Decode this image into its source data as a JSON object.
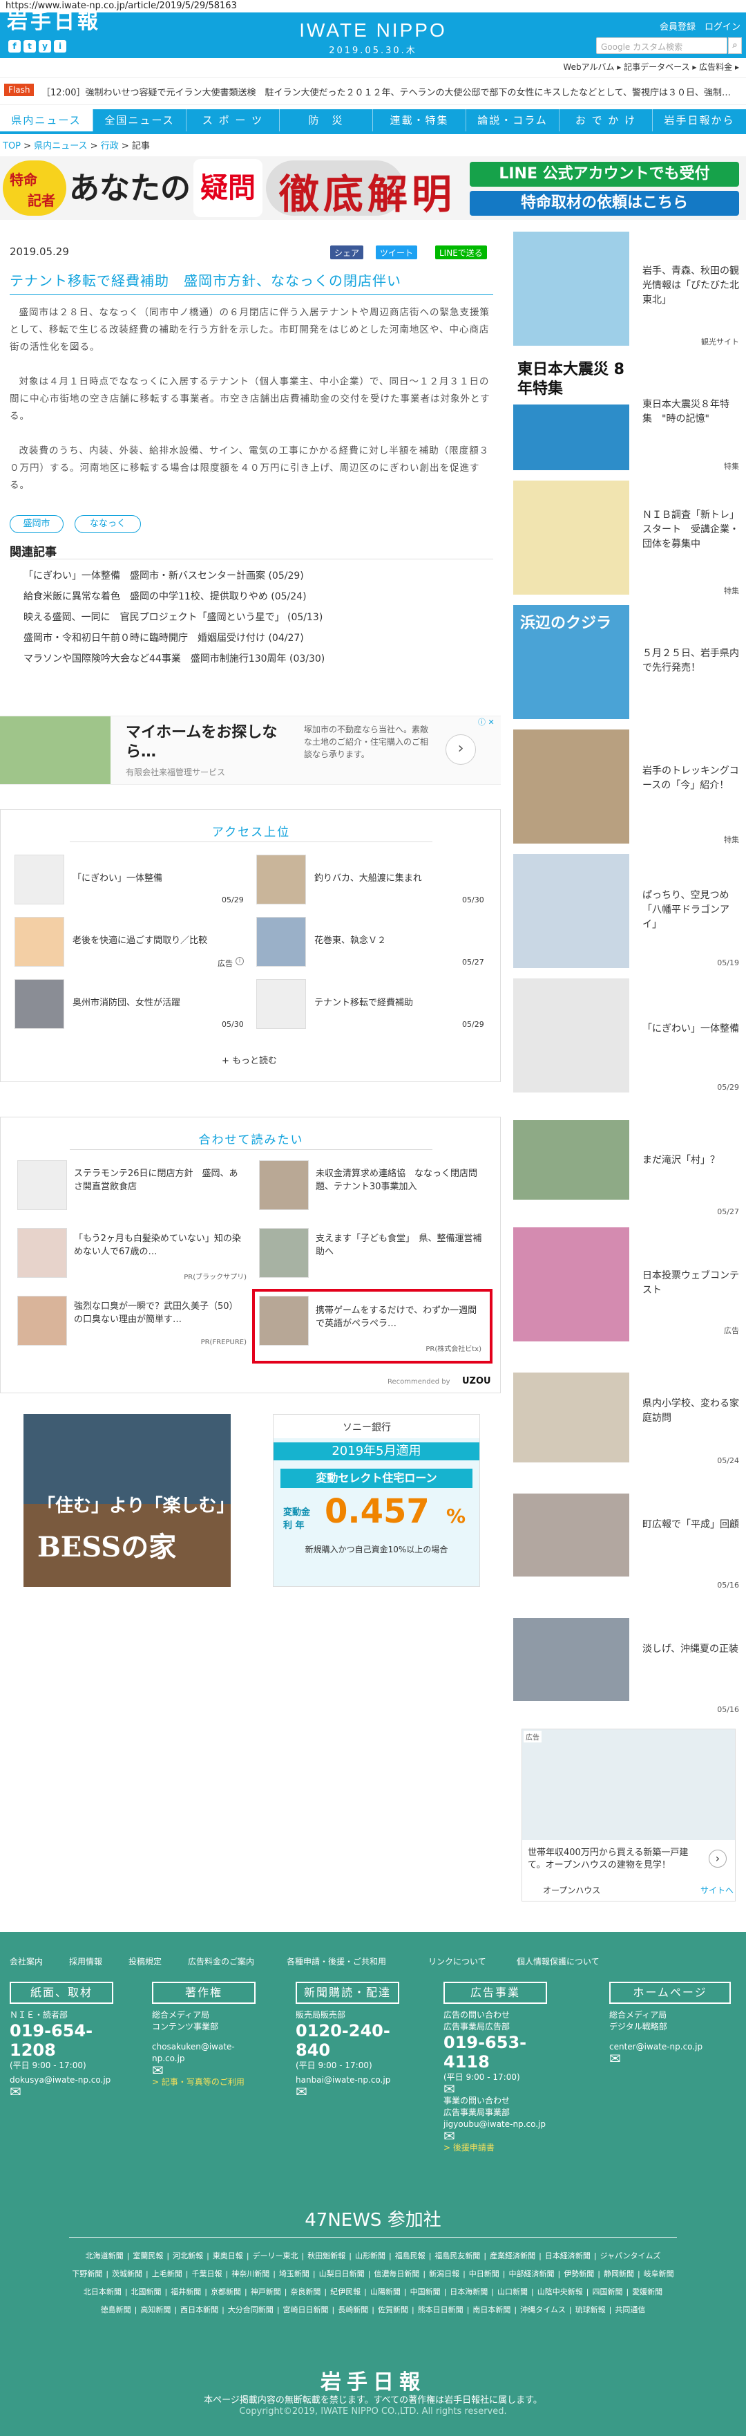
{
  "browser": {
    "url": "https://www.iwate-np.co.jp/article/2019/5/29/58163"
  },
  "header": {
    "logo_jp": "岩手日報",
    "brand": "IWATE NIPPO",
    "date": "2019.05.30.木",
    "member": "会員登録",
    "login": "ログイン",
    "search_placeholder": "Google カスタム検索",
    "search_icon": "magnifier-icon",
    "social": [
      "f",
      "t",
      "y",
      "i"
    ],
    "util": "Webアルバム ▸ 記事データベース ▸ 広告料金 ▸"
  },
  "flash": {
    "badge": "Flash",
    "text": "［12:00］強制わいせつ容疑で元イラン大使書類送検　駐イラン大使だった２０１２年、テヘランの大使公邸で部下の女性にキスしたなどとして、警視庁は３０日、強制…"
  },
  "nav": {
    "items": [
      "県内ニュース",
      "全国ニュース",
      "ス ポ ー ツ",
      "防　災",
      "連載・特集",
      "論説・コラム",
      "お で か け",
      "岩手日報から"
    ],
    "active": 0
  },
  "breadcrumb": {
    "items": [
      "TOP",
      "県内ニュース",
      "行政",
      "記事"
    ]
  },
  "banner": {
    "left1": "特命",
    "left2": "記者",
    "title_a": "あなたの",
    "title_b": "疑問",
    "title_c": "徹底解明",
    "right1": "LINE 公式アカウントでも受付",
    "right2": "特命取材の依頼はこちら"
  },
  "article": {
    "date": "2019.05.29",
    "share": {
      "fb": "シェア",
      "tw": "ツイート",
      "line": "LINEで送る"
    },
    "title": "テナント移転で経費補助　盛岡市方針、ななっくの閉店伴い",
    "paragraphs": [
      "盛岡市は２８日、ななっく（同市中ノ橋通）の６月閉店に伴う入居テナントや周辺商店街への緊急支援策として、移転で生じる改装経費の補助を行う方針を示した。市町開発をはじめとした河南地区や、中心商店街の活性化を図る。",
      "対象は４月１日時点でななっくに入居するテナント（個人事業主、中小企業）で、同日～１２月３１日の間に中心市街地の空き店舗に移転する事業者。市空き店舗出店費補助金の交付を受けた事業者は対象外とする。",
      "改装費のうち、内装、外装、給排水設備、サイン、電気の工事にかかる経費に対し半額を補助（限度額３０万円）する。河南地区に移転する場合は限度額を４０万円に引き上げ、周辺区のにぎわい創出を促進する。"
    ],
    "tags": [
      "盛岡市",
      "ななっく"
    ],
    "related_title": "関連記事",
    "related": [
      "「にぎわい」一体整備　盛岡市・新バスセンター計画案 (05/29)",
      "給食米飯に異常な着色　盛岡の中学11校、提供取りやめ (05/24)",
      "映える盛岡、一同に　官民プロジェクト「盛岡という星で」 (05/13)",
      "盛岡市・令和初日午前０時に臨時開庁　婚姻届受け付け (04/27)",
      "マラソンや国際険吟大会など44事業　盛岡市制施行130周年 (03/30)"
    ]
  },
  "ad1": {
    "title": "マイホームをお探しなら…",
    "sub": "有限会社来福管理サービス",
    "desc": "塚加市の不動産なら当社へ。素敵な土地のご紹介・住宅購入のご相談なら承ります。",
    "badge": "ⓘ ✕"
  },
  "ranking": {
    "title": "アクセス上位",
    "items": [
      {
        "text": "「にぎわい」一体整備",
        "date": "05/29"
      },
      {
        "text": "釣りバカ、大船渡に集まれ",
        "date": "05/30"
      },
      {
        "text": "老後を快適に過ごす間取り／比較",
        "date": "広告",
        "ad": true
      },
      {
        "text": "花巻東、執念Ｖ２",
        "date": "05/27"
      },
      {
        "text": "奥州市消防団、女性が活躍",
        "date": "05/30"
      },
      {
        "text": "テナント移転で経費補助",
        "date": "05/29"
      }
    ],
    "more": "もっと読む"
  },
  "recommend": {
    "title": "合わせて読みたい",
    "items": [
      {
        "text": "ステラモンテ26日に閉店方針　盛岡、あさ開直営飲食店",
        "pr": ""
      },
      {
        "text": "未収金清算求め連絡協　ななっく閉店問題、テナント30事業加入",
        "pr": ""
      },
      {
        "text": "「もう2ヶ月も白髪染めていない」知の染めない人で67歳の…",
        "pr": "PR(ブラックサプリ)"
      },
      {
        "text": "支えます「子ども食堂」　県、整備運営補助へ",
        "pr": ""
      },
      {
        "text": "強烈な口臭が一瞬で？武田久美子（50）の口臭ない理由が簡単す…",
        "pr": "PR(FREPURE)"
      },
      {
        "text": "携帯ゲームをするだけで、わずか一週間で英語がペラペラ…",
        "pr": "PR(株式会社ビtx)"
      }
    ],
    "footer": "Recommended by",
    "brand": "UZOU"
  },
  "ads_bottom": {
    "left_top": "「住む」より「楽しむ」",
    "left_brand": "BESSの家",
    "right_bank": "ソニー銀行",
    "right_year": "2019年5月適用",
    "right_title": "変動セレクト住宅ローン",
    "right_label": "変動金利 年",
    "right_rate": "0.457",
    "right_pct": "%",
    "right_note": "新規購入かつ自己資金10%以上の場合"
  },
  "sidebar": {
    "items": [
      {
        "text": "岩手、青森、秋田の観光情報は「ぴたびた北東北」",
        "date": "観光サイト",
        "color": "#9ecfe8"
      },
      {
        "text": "東日本大震災８年特集　\"時の記憶\"",
        "date": "特集",
        "color": "#2d8dc9",
        "big": "東日本大震災 8年特集"
      },
      {
        "text": "ＮＩＢ調査「新トレ」スタート　受講企業・団体を募集中",
        "date": "特集",
        "color": "#f1e4b0"
      },
      {
        "text": "５月２５日、岩手県内で先行発売！",
        "date": "",
        "color": "#4aa3d6",
        "big": "浜辺のクジラ"
      },
      {
        "text": "岩手のトレッキングコースの「今」紹介！",
        "date": "特集",
        "color": "#b8a080"
      },
      {
        "text": "ぱっちり、空見つめ　「八幡平ドラゴンアイ」",
        "date": "05/19",
        "color": "#c9d7e4"
      },
      {
        "text": "「にぎわい」一体整備",
        "date": "05/29",
        "color": "#e7e7e7"
      },
      {
        "text": "まだ滝沢「村」？",
        "date": "05/27",
        "color": "#8eaa86"
      },
      {
        "text": "日本投票ウェブコンテスト",
        "date": "広告",
        "color": "#d48bb0"
      },
      {
        "text": "県内小学校、変わる家庭訪問",
        "date": "05/24",
        "color": "#d3c9b8"
      },
      {
        "text": "町広報で「平成」回顧",
        "date": "05/16",
        "color": "#b2a7a0"
      },
      {
        "text": "淡しげ、沖縄夏の正装",
        "date": "05/16",
        "color": "#8f9aa6"
      }
    ],
    "ad": {
      "badge": "広告",
      "text": "世帯年収400万円から買える新築一戸建て。オープンハウスの建物を見学！",
      "brand": "オープンハウス",
      "link": "サイトへ"
    }
  },
  "footer": {
    "links": [
      "会社案内",
      "採用情報",
      "投稿規定",
      "広告料金のご案内",
      "各種申請・後援・ご共和用",
      "リンクについて",
      "個人情報保護について"
    ],
    "cols": [
      {
        "head": "紙面、取材",
        "l1": "ＮＩＥ・読者部",
        "tel": "019-654-1208",
        "l2": "(平日 9:00 - 17:00)",
        "mail": "dokusya@iwate-np.co.jp"
      },
      {
        "head": "著作権",
        "l1": "総合メディア局",
        "l2": "コンテンツ事業部",
        "mail": "chosakuken@iwate-np.co.jp",
        "link": "> 記事・写真等のご利用"
      },
      {
        "head": "新聞購読・配達",
        "l1": "販売局販売部",
        "tel": "0120-240-840",
        "l2": "(平日 9:00 - 17:00)",
        "mail": "hanbai@iwate-np.co.jp"
      },
      {
        "head": "広告事業",
        "l1": "広告の問い合わせ",
        "l2": "広告事業局広告部",
        "tel": "019-653-4118",
        "l3": "(平日 9:00 - 17:00)",
        "l4": "事業の問い合わせ",
        "l5": "広告事業局事業部",
        "mail": "jigyoubu@iwate-np.co.jp",
        "link": "> 後援申請書"
      },
      {
        "head": "ホームページ",
        "l1": "総合メディア局",
        "l2": "デジタル戦略部",
        "mail": "center@iwate-np.co.jp"
      }
    ],
    "n47_title": "47NEWS 参加社",
    "n47": [
      [
        "北海道新聞",
        "室蘭民報",
        "河北新報",
        "東奥日報",
        "デーリー東北",
        "秋田魁新報",
        "山形新聞",
        "福島民報",
        "福島民友新聞",
        "産業経済新聞",
        "日本経済新聞",
        "ジャパンタイムズ"
      ],
      [
        "下野新聞",
        "茨城新聞",
        "上毛新聞",
        "千葉日報",
        "神奈川新聞",
        "埼玉新聞",
        "山梨日日新聞",
        "信濃毎日新聞",
        "新潟日報",
        "中日新聞",
        "中部経済新聞",
        "伊勢新聞",
        "静岡新聞",
        "岐阜新聞"
      ],
      [
        "北日本新聞",
        "北國新聞",
        "福井新聞",
        "京都新聞",
        "神戸新聞",
        "奈良新聞",
        "紀伊民報",
        "山陽新聞",
        "中国新聞",
        "日本海新聞",
        "山口新聞",
        "山陰中央新報",
        "四国新聞",
        "愛媛新聞"
      ],
      [
        "徳島新聞",
        "高知新聞",
        "西日本新聞",
        "大分合同新聞",
        "宮崎日日新聞",
        "長崎新聞",
        "佐賀新聞",
        "熊本日日新聞",
        "南日本新聞",
        "沖縄タイムス",
        "琉球新報",
        "共同通信"
      ]
    ],
    "logo": "岩手日報",
    "note": "本ページ掲載内容の無断転載を禁じます。すべての著作権は岩手日報社に属します。",
    "copyright": "Copyright©2019, IWATE NIPPO CO.,LTD. All rights reserved."
  },
  "colors": {
    "accent": "#11a3dd",
    "footer": "#3a9a87",
    "flash": "#e54a1c",
    "highlight": "#e3001b"
  }
}
